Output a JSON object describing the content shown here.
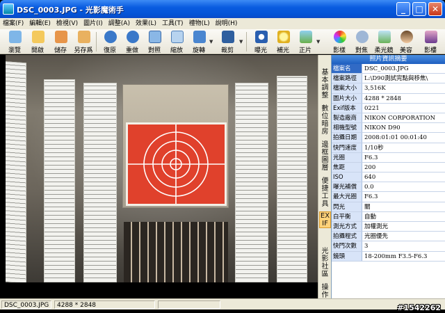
{
  "window": {
    "title": "DSC_0003.JPG - 光影魔術手",
    "minimize_glyph": "_",
    "maximize_glyph": "□",
    "close_glyph": "✕"
  },
  "menu": [
    "檔案(F)",
    "編輯(E)",
    "檢視(V)",
    "圖片(I)",
    "調整(A)",
    "效果(L)",
    "工具(T)",
    "禮物(L)",
    "說明(H)"
  ],
  "toolbar": {
    "buttons": [
      {
        "label": "瀏覽",
        "icon": "eye-icon"
      },
      {
        "label": "開啟",
        "icon": "folder-open-icon"
      },
      {
        "label": "儲存",
        "icon": "save-icon"
      },
      {
        "label": "另存爲",
        "icon": "save-as-icon"
      },
      {
        "label": "復原",
        "icon": "undo-icon"
      },
      {
        "label": "重做",
        "icon": "redo-icon"
      },
      {
        "label": "對照",
        "icon": "compare-icon"
      },
      {
        "label": "縮放",
        "icon": "zoom-icon"
      },
      {
        "label": "旋轉",
        "icon": "rotate-icon"
      },
      {
        "label": "裁剪",
        "icon": "crop-icon"
      },
      {
        "label": "曝光",
        "icon": "exposure-icon"
      },
      {
        "label": "補光",
        "icon": "fill-light-icon"
      },
      {
        "label": "正片",
        "icon": "positive-film-icon"
      },
      {
        "label": "影樣",
        "icon": "color-icon"
      },
      {
        "label": "對焦",
        "icon": "focus-icon"
      },
      {
        "label": "柔光鏡",
        "icon": "soft-lens-icon"
      },
      {
        "label": "美容",
        "icon": "beauty-icon"
      },
      {
        "label": "影樓",
        "icon": "studio-icon"
      }
    ]
  },
  "side_tabs": [
    {
      "label": "基本調整",
      "active": false
    },
    {
      "label": "數位暗房",
      "active": false
    },
    {
      "label": "邊框圖層",
      "active": false
    },
    {
      "label": "便捷工具",
      "active": false
    },
    {
      "label": "EXIF",
      "active": true
    },
    {
      "label": "光影社區",
      "active": false
    },
    {
      "label": "操作",
      "active": false
    }
  ],
  "exif_panel": {
    "title": "照片資訊摘要",
    "rows": [
      {
        "key": "檔案名",
        "value": "DSC_0003.JPG"
      },
      {
        "key": "檔案路徑",
        "value": "L:\\D90測試完點與移焦\\"
      },
      {
        "key": "檔案大小",
        "value": "3,516K"
      },
      {
        "key": "圖片大小",
        "value": "4288 * 2848"
      },
      {
        "key": "Exif版本",
        "value": "0221"
      },
      {
        "key": "製造廠商",
        "value": "NIKON CORPORATION"
      },
      {
        "key": "相機型號",
        "value": "NIKON D90"
      },
      {
        "key": "拍攝日期",
        "value": "2008:01:01 00:01:40"
      },
      {
        "key": "快門速度",
        "value": "1/10秒"
      },
      {
        "key": "光圈",
        "value": "F6.3"
      },
      {
        "key": "焦距",
        "value": "200"
      },
      {
        "key": "ISO",
        "value": "640"
      },
      {
        "key": "曝光補償",
        "value": "0.0"
      },
      {
        "key": "最大光圈",
        "value": "F6.3"
      },
      {
        "key": "閃光",
        "value": "關"
      },
      {
        "key": "白平衡",
        "value": "自動"
      },
      {
        "key": "測光方式",
        "value": "加權測光"
      },
      {
        "key": "拍攝程式",
        "value": "光圈優先"
      },
      {
        "key": "快門次數",
        "value": "3"
      },
      {
        "key": "鏡頭",
        "value": "18-200mm F3.5-F6.3"
      }
    ]
  },
  "statusbar": {
    "filename": "DSC_0003.JPG",
    "dimensions": "4288 * 2848"
  },
  "watermark": "#1542262",
  "colors": {
    "titlebar": "#0353d6",
    "target_red": "#e0412c",
    "panel_key_bg": "#d8e4f8",
    "active_tab": "#ffd27a"
  }
}
